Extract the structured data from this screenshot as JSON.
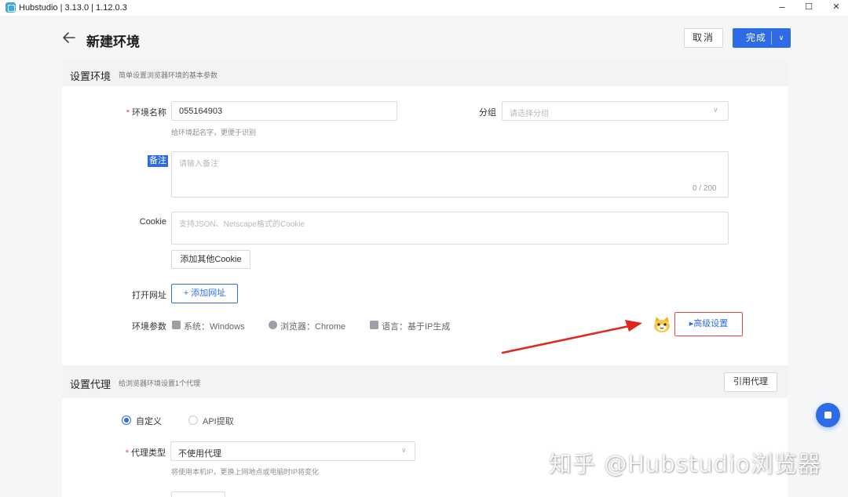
{
  "window": {
    "title": "Hubstudio | 3.13.0 | 1.12.0.3",
    "minimize": "–",
    "maximize": "☐",
    "close": "✕"
  },
  "header": {
    "title": "新建环境",
    "cancel_label": "取消",
    "done_label": "完成"
  },
  "env_section": {
    "title": "设置环境",
    "subtitle": "简单设置浏览器环境的基本参数"
  },
  "env_name": {
    "label": "环境名称",
    "value": "055164903",
    "hint": "给环境起名字，更便于识别"
  },
  "group": {
    "label": "分组",
    "placeholder": "请选择分组"
  },
  "remark": {
    "label": "备注",
    "placeholder": "请输入备注",
    "counter": "0 / 200"
  },
  "cookie": {
    "label": "Cookie",
    "placeholder": "支持JSON、Netscape格式的Cookie",
    "add_button": "添加其他Cookie"
  },
  "open_url": {
    "label": "打开网址",
    "add_button": "+  添加网址"
  },
  "env_params": {
    "label": "环境参数",
    "system": "系统：Windows",
    "browser": "浏览器：Chrome",
    "language": "语言：基于IP生成",
    "advanced_button": "▸高级设置"
  },
  "proxy_section": {
    "title": "设置代理",
    "subtitle": "给浏览器环境设置1个代理",
    "quote_button": "引用代理"
  },
  "proxy_mode": {
    "custom": "自定义",
    "api": "API提取",
    "selected": "custom"
  },
  "proxy_type": {
    "label": "代理类型",
    "value": "不使用代理",
    "hint": "将使用本机IP，更换上网地点或电脑时IP将变化"
  },
  "watermark": "知乎 @Hubstudio浏览器",
  "colors": {
    "primary": "#2e6be6",
    "danger": "#e5484d",
    "page_bg": "#f5f6f8"
  }
}
